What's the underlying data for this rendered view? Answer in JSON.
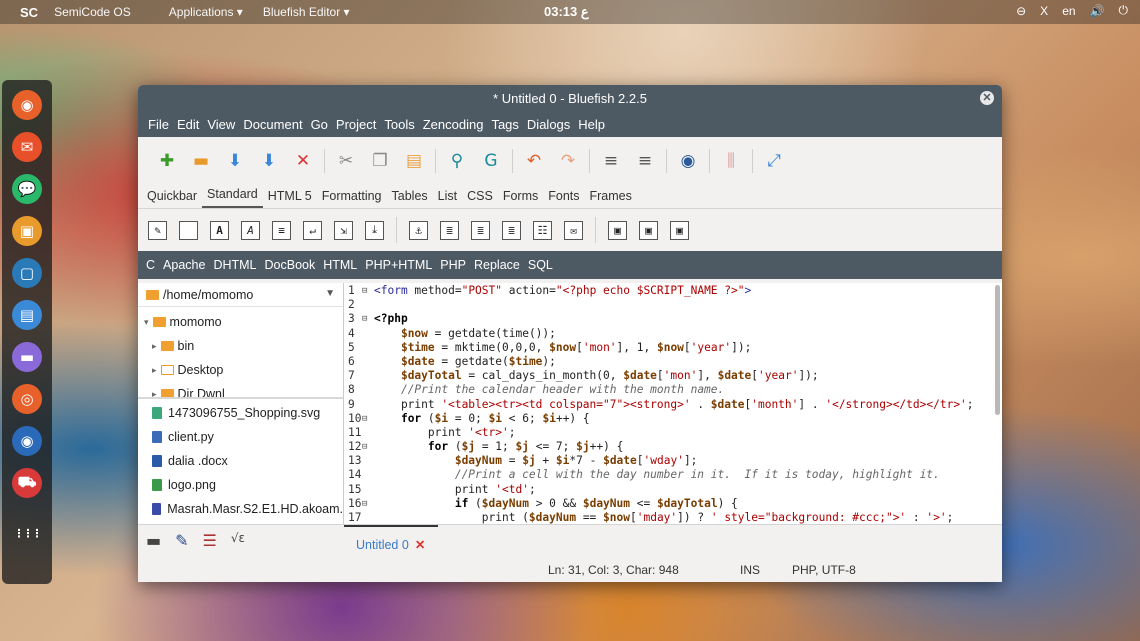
{
  "top_panel": {
    "logo": "SC",
    "os_name": "SemiCode OS",
    "applications": "Applications ▾",
    "active_app": "Bluefish Editor ▾",
    "clock": "03:13 ع",
    "right_items": [
      "⊖",
      "X",
      "en",
      "🔊",
      "⏻"
    ]
  },
  "window": {
    "title": "* Untitled 0 - Bluefish 2.2.5",
    "menu": [
      "File",
      "Edit",
      "View",
      "Document",
      "Go",
      "Project",
      "Tools",
      "Zencoding",
      "Tags",
      "Dialogs",
      "Help"
    ],
    "toolbar_icons": [
      {
        "name": "new-icon",
        "glyph": "✚",
        "color": "#3a9a2a"
      },
      {
        "name": "open-icon",
        "glyph": "▬",
        "color": "#e89a2a"
      },
      {
        "name": "save-icon",
        "glyph": "⬇",
        "color": "#3a86d8"
      },
      {
        "name": "save-as-icon",
        "glyph": "⬇",
        "color": "#3a86d8"
      },
      {
        "name": "close-icon",
        "glyph": "✕",
        "color": "#d33"
      },
      {
        "name": "sep"
      },
      {
        "name": "cut-icon",
        "glyph": "✂",
        "color": "#888"
      },
      {
        "name": "copy-icon",
        "glyph": "❐",
        "color": "#888"
      },
      {
        "name": "paste-icon",
        "glyph": "▤",
        "color": "#e8a040"
      },
      {
        "name": "sep"
      },
      {
        "name": "find-icon",
        "glyph": "⚲",
        "color": "#1a8a9a"
      },
      {
        "name": "replace-icon",
        "glyph": "G",
        "color": "#1a8a9a"
      },
      {
        "name": "sep"
      },
      {
        "name": "undo-icon",
        "glyph": "↶",
        "color": "#e0602a"
      },
      {
        "name": "redo-icon",
        "glyph": "↷",
        "color": "#e8a080"
      },
      {
        "name": "sep"
      },
      {
        "name": "indent-icon",
        "glyph": "≡",
        "color": "#555"
      },
      {
        "name": "unindent-icon",
        "glyph": "≡",
        "color": "#555"
      },
      {
        "name": "sep"
      },
      {
        "name": "preview-icon",
        "glyph": "◉",
        "color": "#2a5a9a"
      },
      {
        "name": "sep"
      },
      {
        "name": "options-icon",
        "glyph": "⫼",
        "color": "#d8a0a0"
      },
      {
        "name": "sep"
      },
      {
        "name": "fullscreen-icon",
        "glyph": "⤢",
        "color": "#3a86d8"
      }
    ],
    "htmlbar_tabs": [
      "Quickbar",
      "Standard",
      "HTML 5",
      "Formatting",
      "Tables",
      "List",
      "CSS",
      "Forms",
      "Fonts",
      "Frames"
    ],
    "htmlbar_active": "Standard",
    "htmlbar_icons": [
      {
        "name": "quickstart-icon",
        "glyph": "✎"
      },
      {
        "name": "body-icon",
        "glyph": ""
      },
      {
        "name": "bold-icon",
        "glyph": "A"
      },
      {
        "name": "italic-icon",
        "glyph": "A"
      },
      {
        "name": "paragraph-icon",
        "glyph": "≡"
      },
      {
        "name": "break-icon",
        "glyph": "↵"
      },
      {
        "name": "break-clear-icon",
        "glyph": "⇲"
      },
      {
        "name": "nbsp-icon",
        "glyph": "⤓"
      },
      {
        "name": "sep"
      },
      {
        "name": "anchor-icon",
        "glyph": "⚓"
      },
      {
        "name": "hr-icon",
        "glyph": "≣"
      },
      {
        "name": "center-icon",
        "glyph": "≣"
      },
      {
        "name": "right-align-icon",
        "glyph": "≣"
      },
      {
        "name": "comment-icon",
        "glyph": "☷"
      },
      {
        "name": "email-icon",
        "glyph": "✉"
      },
      {
        "name": "sep"
      },
      {
        "name": "image-icon",
        "glyph": "▣"
      },
      {
        "name": "thumbnail-icon",
        "glyph": "▣"
      },
      {
        "name": "multi-thumbnail-icon",
        "glyph": "▣"
      }
    ],
    "snippets": [
      "C",
      "Apache",
      "DHTML",
      "DocBook",
      "HTML",
      "PHP+HTML",
      "PHP",
      "Replace",
      "SQL"
    ],
    "sidebar": {
      "path": "/home/momomo",
      "tree": [
        {
          "indent": 6,
          "arrow": "▾",
          "label": "momomo",
          "type": "folder"
        },
        {
          "indent": 14,
          "arrow": "▸",
          "label": "bin",
          "type": "folder"
        },
        {
          "indent": 14,
          "arrow": "▸",
          "label": "Desktop",
          "type": "desktop"
        },
        {
          "indent": 14,
          "arrow": "▸",
          "label": "Dir Dwnl ",
          "type": "folder"
        }
      ],
      "files": [
        {
          "label": "1473096755_Shopping.svg",
          "color": "#3aa87a"
        },
        {
          "label": "client.py",
          "color": "#3a6ab8"
        },
        {
          "label": "dalia .docx",
          "color": "#2a5aa8"
        },
        {
          "label": "logo.png",
          "color": "#3a9a4a"
        },
        {
          "label": "Masrah.Masr.S2.E1.HD.akoam.",
          "color": "#3a4aa8"
        }
      ]
    },
    "code": [
      {
        "n": "1",
        "fold": "⊟",
        "html": "<span class='c-tag'>&lt;form</span> method=<span class='c-str'>\"POST\"</span> action=<span class='c-str'>\"&lt;?php echo $SCRIPT_NAME ?&gt;\"</span><span class='c-tag'>&gt;</span>"
      },
      {
        "n": "2",
        "fold": "",
        "html": ""
      },
      {
        "n": "3",
        "fold": "⊟",
        "html": "<span class='c-php'>&lt;?php</span>"
      },
      {
        "n": "4",
        "fold": "",
        "html": "    <span class='c-var'>$now</span> = getdate(time());"
      },
      {
        "n": "5",
        "fold": "",
        "html": "    <span class='c-var'>$time</span> = mktime(0,0,0, <span class='c-var'>$now</span>[<span class='c-str'>'mon'</span>], 1, <span class='c-var'>$now</span>[<span class='c-str'>'year'</span>]);"
      },
      {
        "n": "6",
        "fold": "",
        "html": "    <span class='c-var'>$date</span> = getdate(<span class='c-var'>$time</span>);"
      },
      {
        "n": "7",
        "fold": "",
        "html": "    <span class='c-var'>$dayTotal</span> = cal_days_in_month(0, <span class='c-var'>$date</span>[<span class='c-str'>'mon'</span>], <span class='c-var'>$date</span>[<span class='c-str'>'year'</span>]);"
      },
      {
        "n": "8",
        "fold": "",
        "html": "    <span class='c-cmt'>//Print the calendar header with the month name.</span>"
      },
      {
        "n": "9",
        "fold": "",
        "html": "    print <span class='c-str'>'&lt;table&gt;&lt;tr&gt;&lt;td colspan=\"7\"&gt;&lt;strong&gt;'</span> . <span class='c-var'>$date</span>[<span class='c-str'>'month'</span>] . <span class='c-str'>'&lt;/strong&gt;&lt;/td&gt;&lt;/tr&gt;'</span>;"
      },
      {
        "n": "10",
        "fold": "⊟",
        "html": "    <span class='c-kw'>for</span> (<span class='c-var'>$i</span> = 0; <span class='c-var'>$i</span> &lt; 6; <span class='c-var'>$i</span>++) {"
      },
      {
        "n": "11",
        "fold": "",
        "html": "        print <span class='c-str'>'&lt;tr&gt;'</span>;"
      },
      {
        "n": "12",
        "fold": "⊟",
        "html": "        <span class='c-kw'>for</span> (<span class='c-var'>$j</span> = 1; <span class='c-var'>$j</span> &lt;= 7; <span class='c-var'>$j</span>++) {"
      },
      {
        "n": "13",
        "fold": "",
        "html": "            <span class='c-var'>$dayNum</span> = <span class='c-var'>$j</span> + <span class='c-var'>$i</span>*7 - <span class='c-var'>$date</span>[<span class='c-str'>'wday'</span>];"
      },
      {
        "n": "14",
        "fold": "",
        "html": "            <span class='c-cmt'>//Print a cell with the day number in it.  If it is today, highlight it.</span>"
      },
      {
        "n": "15",
        "fold": "",
        "html": "            print <span class='c-str'>'&lt;td'</span>;"
      },
      {
        "n": "16",
        "fold": "⊟",
        "html": "            <span class='c-kw'>if</span> (<span class='c-var'>$dayNum</span> &gt; 0 &amp;&amp; <span class='c-var'>$dayNum</span> &lt;= <span class='c-var'>$dayTotal</span>) {"
      },
      {
        "n": "17",
        "fold": "",
        "html": "                print (<span class='c-var'>$dayNum</span> == <span class='c-var'>$now</span>[<span class='c-str'>'mday'</span>]) ? <span class='c-str'>' style=\"background: #ccc;\"&gt;'</span> : <span class='c-str'>'&gt;'</span>;"
      }
    ],
    "document_tab": "Untitled 0",
    "document_tab_close": "✕",
    "status": {
      "position": "Ln: 31, Col: 3, Char: 948",
      "mode": "INS",
      "encoding": "PHP, UTF-8"
    }
  },
  "dock_icons": [
    {
      "name": "firefox-icon",
      "color": "#e8602a",
      "glyph": "◉"
    },
    {
      "name": "mail-icon",
      "color": "#e8502a",
      "glyph": "✉"
    },
    {
      "name": "chat-icon",
      "color": "#2ab86a",
      "glyph": "💬"
    },
    {
      "name": "disk-icon",
      "color": "#e89a2a",
      "glyph": "▣"
    },
    {
      "name": "box-icon",
      "color": "#2a7ab8",
      "glyph": "▢"
    },
    {
      "name": "notes-icon",
      "color": "#3a8ad8",
      "glyph": "▤"
    },
    {
      "name": "folder-icon",
      "color": "#8a6ad8",
      "glyph": "▬"
    },
    {
      "name": "help-icon",
      "color": "#e8602a",
      "glyph": "◎"
    },
    {
      "name": "media-icon",
      "color": "#2a6ab8",
      "glyph": "◉"
    },
    {
      "name": "store-icon",
      "color": "#d83a3a",
      "glyph": "⛟"
    },
    {
      "name": "apps-grid-icon",
      "color": "transparent",
      "glyph": "⋮⋮⋮"
    }
  ]
}
